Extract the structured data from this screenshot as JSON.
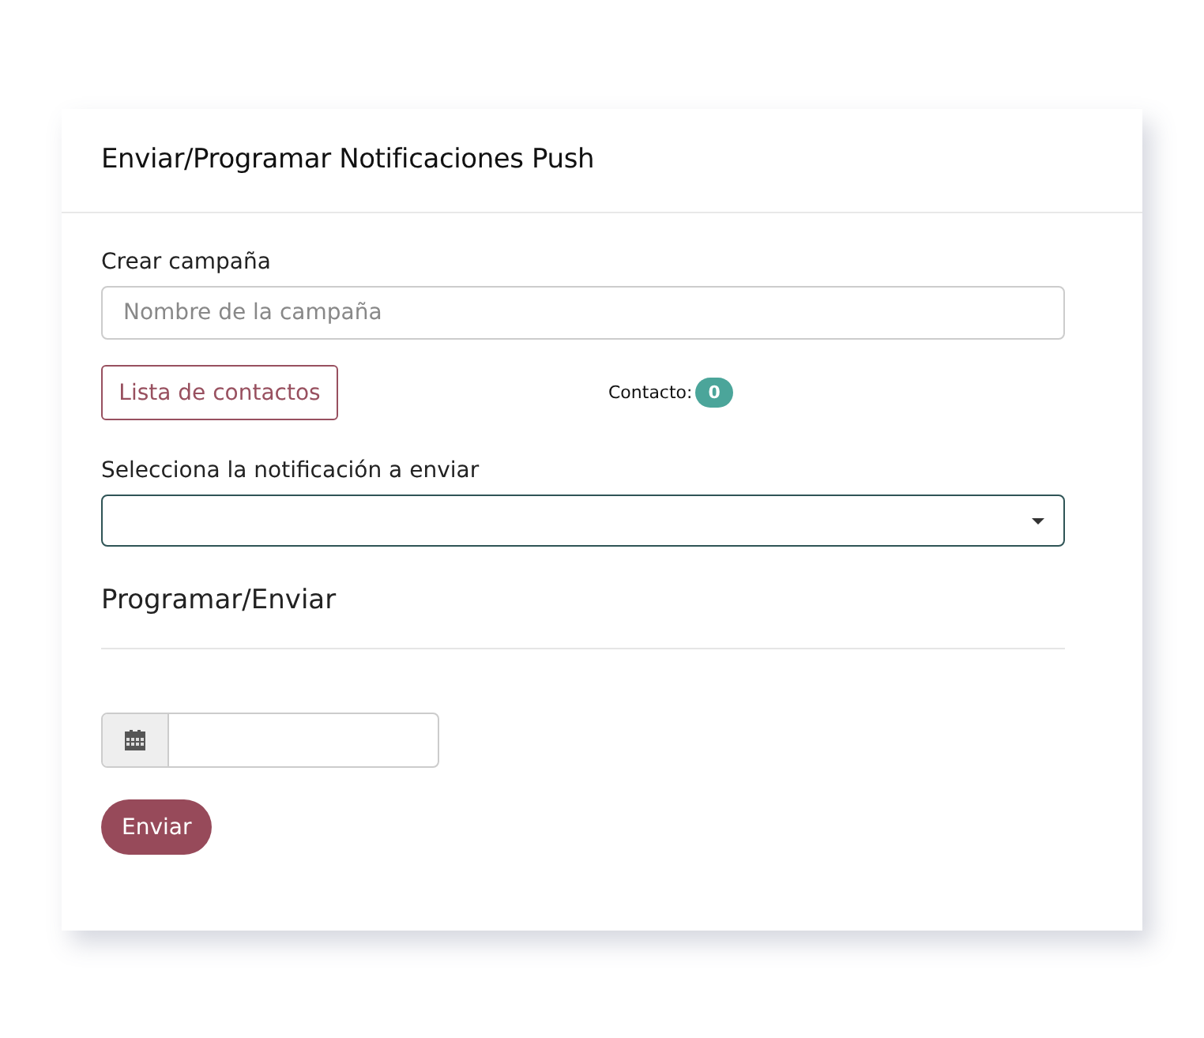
{
  "card": {
    "title": "Enviar/Programar Notificaciones Push"
  },
  "campaign": {
    "label": "Crear campaña",
    "placeholder": "Nombre de la campaña"
  },
  "contacts_button": "Lista de contactos",
  "contact_count": {
    "label": "Contacto:",
    "count": "0"
  },
  "notification": {
    "label": "Selecciona la notificación a enviar"
  },
  "schedule": {
    "heading": "Programar/Enviar"
  },
  "submit_button": "Enviar"
}
